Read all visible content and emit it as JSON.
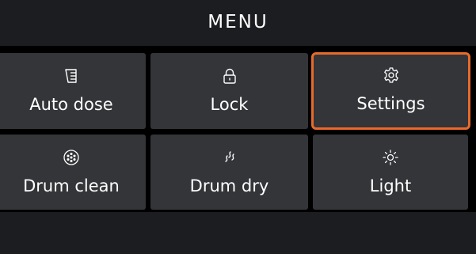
{
  "header": {
    "title": "MENU"
  },
  "colors": {
    "background": "#000000",
    "header_bg": "#1b1d20",
    "tile_bg": "#333538",
    "selected_border": "#e86a2a",
    "text": "#ffffff"
  },
  "menu": {
    "selected": "Settings",
    "items": [
      {
        "label": "Auto dose",
        "icon": "detergent-container-icon"
      },
      {
        "label": "Lock",
        "icon": "padlock-icon"
      },
      {
        "label": "Settings",
        "icon": "gear-icon"
      },
      {
        "label": "Drum clean",
        "icon": "drum-icon"
      },
      {
        "label": "Drum dry",
        "icon": "airflow-icon"
      },
      {
        "label": "Light",
        "icon": "sun-icon"
      }
    ]
  }
}
